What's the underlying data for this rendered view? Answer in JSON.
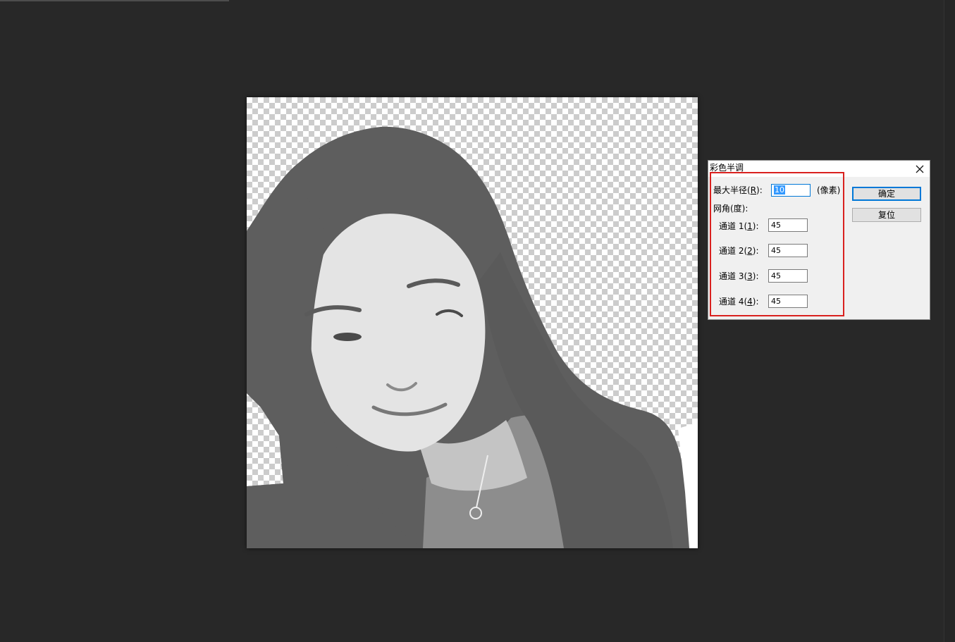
{
  "colors": {
    "workspace": "#282828",
    "dialog_bg": "#f0f0f0",
    "highlight_box": "#d9211f",
    "accent": "#0078d7",
    "selection": "#3399ff"
  },
  "icons": {
    "close": "close-icon"
  },
  "dialog": {
    "title": "彩色半调",
    "radius": {
      "label_prefix": "最大半径(",
      "label_key": "R",
      "label_suffix": "):",
      "value": "10",
      "unit": "(像素)"
    },
    "angles_heading": "网角(度):",
    "channels": [
      {
        "label_prefix": "通道 1(",
        "label_key": "1",
        "label_suffix": "):",
        "value": "45"
      },
      {
        "label_prefix": "通道 2(",
        "label_key": "2",
        "label_suffix": "):",
        "value": "45"
      },
      {
        "label_prefix": "通道 3(",
        "label_key": "3",
        "label_suffix": "):",
        "value": "45"
      },
      {
        "label_prefix": "通道 4(",
        "label_key": "4",
        "label_suffix": "):",
        "value": "45"
      }
    ],
    "ok_label": "确定",
    "reset_label": "复位"
  }
}
